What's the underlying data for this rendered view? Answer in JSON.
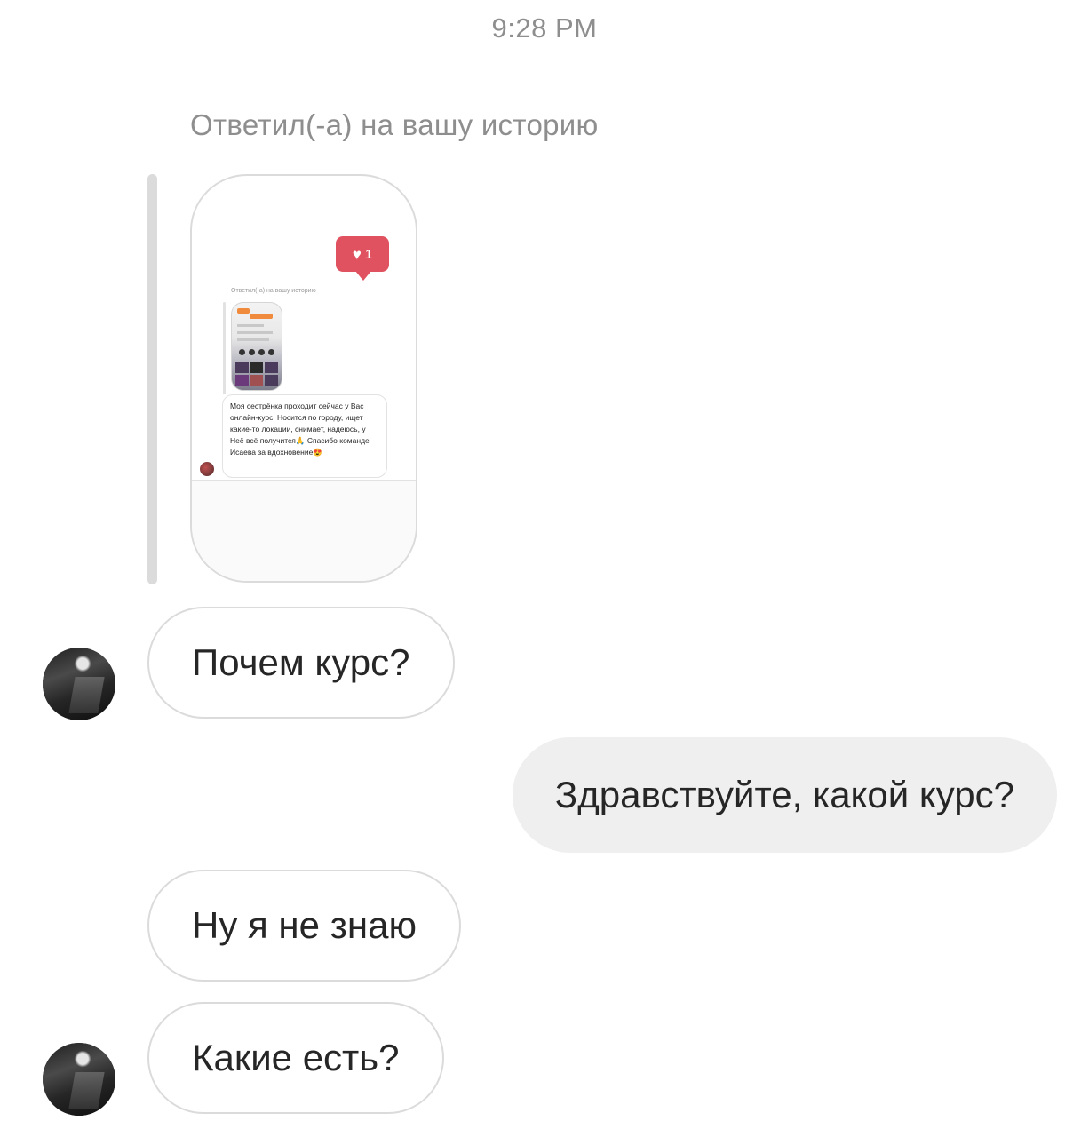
{
  "header": {
    "timestamp": "9:28 PM"
  },
  "story_reply": {
    "label": "Ответил(-а) на вашу историю",
    "preview": {
      "like_count": "1",
      "inner_label": "Ответил(-а) на вашу историю",
      "inner_message": "Моя сестрёнка проходит сейчас у Вас онлайн-курс. Носится по городу, ищет какие-то локации, снимает, надеюсь, у Неё всё получится🙏 Спасибо команде Исаева за вдохновение😍"
    }
  },
  "messages": [
    {
      "from": "them",
      "text": "Почем курс?"
    },
    {
      "from": "me",
      "text": "Здравствуйте, какой курс?"
    },
    {
      "from": "them",
      "text": "Ну я не знаю"
    },
    {
      "from": "them",
      "text": "Какие есть?"
    }
  ],
  "colors": {
    "like_badge": "#e0525f",
    "outgoing_bubble": "#efefef",
    "border": "#dbdbdb",
    "secondary_text": "#8e8e8e"
  }
}
